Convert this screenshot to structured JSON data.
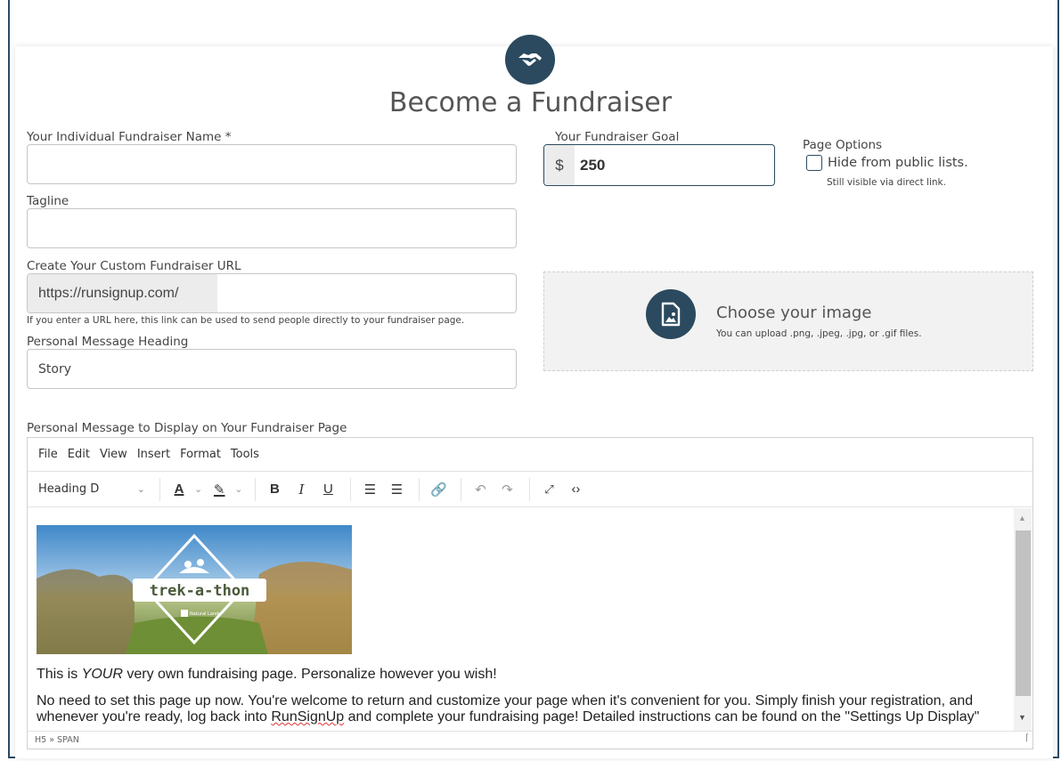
{
  "page": {
    "title": "Become a Fundraiser"
  },
  "form": {
    "name_label": "Your Individual Fundraiser Name *",
    "name_value": "",
    "tagline_label": "Tagline",
    "tagline_value": "",
    "goal_label": "Your Fundraiser Goal",
    "goal_prefix": "$",
    "goal_value": "250",
    "page_options_label": "Page Options",
    "hide_label": "Hide from public lists.",
    "hide_checked": false,
    "hide_hint": "Still visible via direct link.",
    "url_label": "Create Your Custom Fundraiser URL",
    "url_prefix": "https://runsignup.com/",
    "url_value": "",
    "url_hint": "If you enter a URL here, this link can be used to send people directly to your fundraiser page.",
    "heading_label": "Personal Message Heading",
    "heading_value": "Story",
    "message_label": "Personal Message to Display on Your Fundraiser Page"
  },
  "image_upload": {
    "title": "Choose your image",
    "hint": "You can upload .png, .jpeg, .jpg, or .gif files."
  },
  "editor": {
    "menu": [
      "File",
      "Edit",
      "View",
      "Insert",
      "Format",
      "Tools"
    ],
    "block_format": "Heading D",
    "hero_text": "trek-a-thon",
    "hero_small": "Natural Lands",
    "msg1_before": "This is ",
    "msg1_em": "YOUR",
    "msg1_after": " very own fundraising page. Personalize however you wish!",
    "msg2_before": "No need to set this page up now. You're welcome to return and customize your page when it's convenient for you. Simply finish your registration, and whenever you're ready, log back into ",
    "msg2_link": "RunSignUp",
    "msg2_after": " and complete your fundraising page! Detailed instructions can be found on the \"Settings Up Display\"",
    "status_path": "H5 » SPAN"
  },
  "colors": {
    "brand": "#2b4a5f",
    "field_border": "#c6c6c6",
    "prefix_bg": "#ececec"
  }
}
